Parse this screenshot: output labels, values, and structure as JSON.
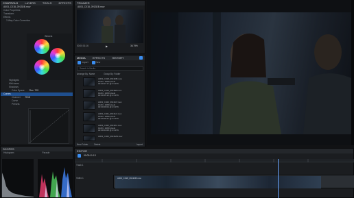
{
  "left_panel": {
    "tabs": [
      "CONTROLS",
      "LAYERS",
      "TOOLS",
      "EFFECTS"
    ],
    "clip_name": "A003_C018_0913DB.mov",
    "sections": [
      "Color Properties",
      "Transform",
      "Effects"
    ],
    "effect_name": "3 Way Color Correction",
    "wheel_group_label": "Wheels",
    "params": [
      "Highlights",
      "Mid-tones",
      "Shadows"
    ],
    "color_space_label": "Color Space",
    "color_space_value": "Rec. 709",
    "curves_label": "Curves",
    "channel_label": "Channel",
    "channel_value": "RGB",
    "curve_label": "Curve",
    "presets_label": "Presets"
  },
  "scopes": {
    "title": "SCOPES",
    "mode": "Histogram",
    "parade_label": "Parade"
  },
  "trimmer": {
    "title": "TRIMMER",
    "clip_name": "A003_C018_0913DB.mov",
    "timecode": "00:00:01:16",
    "zoom": "36.79%"
  },
  "media": {
    "tabs": [
      "MEDIA",
      "EFFECTS",
      "HISTORY"
    ],
    "import_label": "Import",
    "new_label": "New",
    "search_placeholder": "Search in Media",
    "arrange_label": "Arrange By: Name",
    "group_label": "Group By: Folder",
    "files": [
      {
        "name": "A003_C018_0913DB.mov",
        "lines": [
          "1920 x 1080 pixels",
          "00:00:07:17 @ 23.976"
        ]
      },
      {
        "name": "A003_C019_0913EF.mov",
        "lines": [
          "1920 x 1080 pixels",
          "00:00:05:12 @ 23.976"
        ]
      },
      {
        "name": "A003_C020_0913GT.mov",
        "lines": [
          "1920 x 1080 pixels",
          "00:00:09:04 @ 23.976"
        ]
      },
      {
        "name": "A003_C021_0913HJ.mov",
        "lines": [
          "1920 x 1080 pixels",
          "00:00:06:21 @ 23.976"
        ]
      },
      {
        "name": "A003_C022_0913KL.mov",
        "lines": [
          "1920 x 1080 pixels",
          "00:00:04:08 @ 23.976"
        ]
      },
      {
        "name": "A003_C023_0913MN.mov",
        "lines": [
          "1920 x 1080 pixels",
          "00:00:08:15 @ 23.976"
        ]
      }
    ],
    "new_folder_label": "New Folder",
    "delete_label": "Delete",
    "import_footer_label": "Import"
  },
  "editor": {
    "title": "EDITOR",
    "timecode": "00:03:11:13",
    "tracks": [
      "Track 1",
      "Video 1"
    ],
    "clip_label": "A003_C018_0913DB.mov"
  }
}
